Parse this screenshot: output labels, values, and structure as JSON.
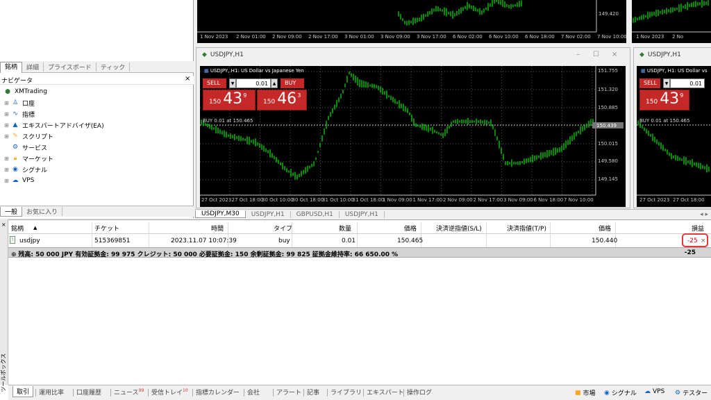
{
  "market_watch_tabs": [
    "銘柄",
    "詳細",
    "プライスボード",
    "ティック"
  ],
  "navigator": {
    "title": "ナビゲータ",
    "close": "×",
    "root": "XMTrading",
    "items": [
      {
        "label": "口座",
        "icon": "accounts-icon"
      },
      {
        "label": "指標",
        "icon": "indicators-icon"
      },
      {
        "label": "エキスパートアドバイザ(EA)",
        "icon": "expert-advisor-icon"
      },
      {
        "label": "スクリプト",
        "icon": "scripts-icon"
      },
      {
        "label": "サービス",
        "icon": "services-icon"
      },
      {
        "label": "マーケット",
        "icon": "market-icon"
      },
      {
        "label": "シグナル",
        "icon": "signals-icon"
      },
      {
        "label": "VPS",
        "icon": "vps-icon"
      }
    ],
    "tabs": [
      "一般",
      "お気に入り"
    ]
  },
  "top_chart": {
    "price_ticks": [
      "149.420"
    ],
    "time_ticks": [
      "1 Nov 2023",
      "2 Nov 01:00",
      "2 Nov 09:00",
      "2 Nov 17:00",
      "3 Nov 01:00",
      "3 Nov 09:00",
      "3 Nov 17:00",
      "6 Nov 02:00",
      "6 Nov 10:00",
      "6 Nov 18:00",
      "7 Nov 02:00",
      "7 Nov 10:00"
    ]
  },
  "top_chart_right": {
    "time_ticks": [
      "1 Nov 2023",
      "2 No"
    ]
  },
  "main_chart_window": {
    "title": "USDJPY,H1",
    "header": "USDJPY, H1:  US Dollar vs Japanese Yen",
    "sell_label": "SELL",
    "buy_label": "BUY",
    "lot": "0.01",
    "bid_small": "150",
    "bid_big": "43",
    "bid_sup": "9",
    "ask_small": "150",
    "ask_big": "46",
    "ask_sup": "3",
    "buy_line_label": "BUY 0.01 at 150.465",
    "current_price": "150.439",
    "price_ticks": [
      "151.755",
      "151.320",
      "150.885",
      "150.015",
      "149.580",
      "149.145"
    ],
    "time_ticks": [
      "27 Oct 2023",
      "27 Oct 18:00",
      "30 Oct 10:00",
      "30 Oct 18:00",
      "31 Oct 10:00",
      "31 Oct 18:00",
      "1 Nov 09:00",
      "1 Nov 17:00",
      "2 Nov 09:00",
      "2 Nov 17:00",
      "3 Nov 09:00",
      "6 Nov 18:00",
      "7 Nov 10:00"
    ]
  },
  "right_chart_window": {
    "title": "USDJPY,H1",
    "header": "USDJPY, H1:  US Dollar vs",
    "sell_label": "SELL",
    "lot": "0.01",
    "bid_small": "150",
    "bid_big": "43",
    "bid_sup": "9",
    "buy_line_label": "BUY 0.01 at 150.465",
    "time_ticks": [
      "27 Oct 2023",
      "27 Oct 18:00"
    ]
  },
  "chart_tabs": [
    "USDJPY,M30",
    "USDJPY,H1",
    "GBPUSD,H1",
    "USDJPY,H1"
  ],
  "terminal": {
    "side_label": "ツールボックス",
    "close": "×",
    "columns": [
      "銘柄",
      "チケット",
      "時間",
      "タイプ",
      "数量",
      "価格",
      "決済逆指値(S/L)",
      "決済指値(T/P)",
      "価格",
      "損益"
    ],
    "sort_indicator": "▲",
    "row": {
      "symbol": "usdjpy",
      "ticket": "515369851",
      "time": "2023.11.07 10:07:39",
      "type": "buy",
      "volume": "0.01",
      "open_price": "150.465",
      "sl": "",
      "tp": "",
      "current_price": "150.440",
      "profit": "-25",
      "close": "×"
    },
    "summary": "残高: 50 000 JPY  有効証拠金: 99 975  クレジット: 50 000  必要証拠金: 150  余剰証拠金: 99 825  証拠金維持率: 66 650.00 %",
    "summary_profit": "-25"
  },
  "bottom_tabs": [
    {
      "label": "取引",
      "badge": ""
    },
    {
      "label": "運用比率",
      "badge": ""
    },
    {
      "label": "口座履歴",
      "badge": ""
    },
    {
      "label": "ニュース",
      "badge": "99"
    },
    {
      "label": "受信トレイ",
      "badge": "10"
    },
    {
      "label": "指標カレンダー",
      "badge": ""
    },
    {
      "label": "会社",
      "badge": ""
    },
    {
      "label": "アラート",
      "badge": ""
    },
    {
      "label": "記事",
      "badge": ""
    },
    {
      "label": "ライブラリ",
      "badge": ""
    },
    {
      "label": "エキスパート",
      "badge": ""
    },
    {
      "label": "操作ログ",
      "badge": ""
    }
  ],
  "status_bar": [
    "市場",
    "シグナル",
    "VPS",
    "テスター"
  ],
  "colors": {
    "sell": "#c62828",
    "candle": "#00c800",
    "highlight": "#e53935"
  }
}
